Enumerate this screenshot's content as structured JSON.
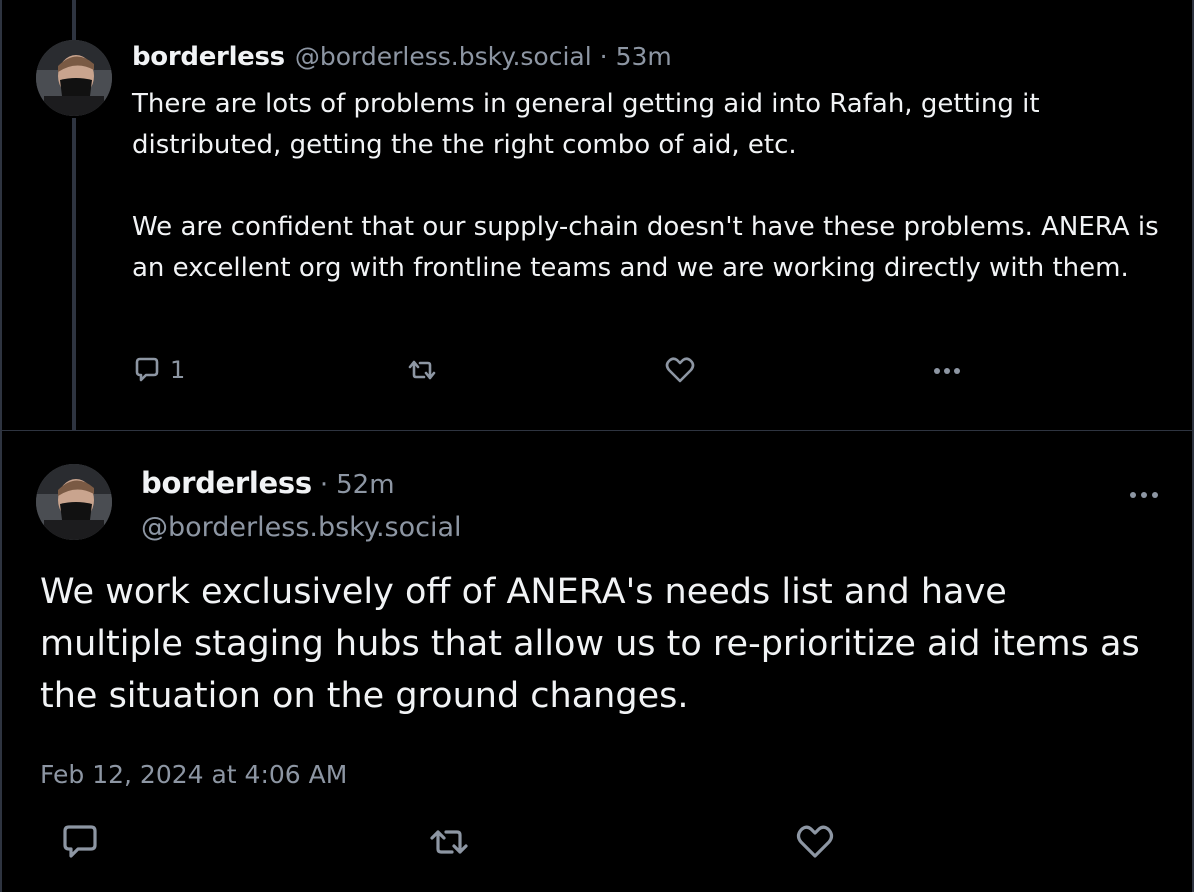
{
  "reply_post": {
    "author_name": "borderless",
    "author_handle": "@borderless.bsky.social",
    "separator": "·",
    "time_ago": "53m",
    "paragraphs": [
      "There are lots of problems in general getting aid into Rafah, getting it distributed, getting the the right combo of aid, etc.",
      "We are confident that our supply-chain doesn't have these problems. ANERA is an excellent org with frontline teams and we are working directly with them."
    ],
    "actions": {
      "reply_count": "1",
      "reply_icon": "reply-bubble-icon",
      "repost_icon": "repost-icon",
      "like_icon": "heart-icon",
      "more_icon": "more-dots-icon"
    }
  },
  "main_post": {
    "author_name": "borderless",
    "separator": "·",
    "time_ago": "52m",
    "author_handle": "@borderless.bsky.social",
    "body": "We work exclusively off of ANERA's needs list and have multiple staging hubs that allow us to re-prioritize aid items as the situation on the ground changes.",
    "timestamp": "Feb 12, 2024 at 4:06 AM",
    "actions": {
      "reply_icon": "reply-bubble-icon",
      "repost_icon": "repost-icon",
      "like_icon": "heart-icon",
      "more_icon": "more-dots-icon"
    }
  },
  "colors": {
    "background": "#000000",
    "text_primary": "#f1f3f5",
    "text_secondary": "#8d96a3",
    "border": "#2e3440"
  }
}
